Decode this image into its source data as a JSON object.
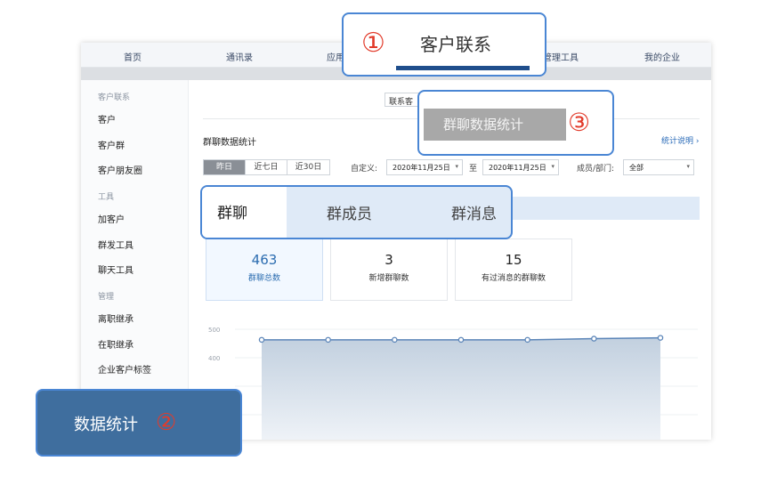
{
  "topnav": {
    "items": [
      "首页",
      "通讯录",
      "应用",
      "管理工具",
      "我的企业"
    ]
  },
  "sidebar": {
    "sections": [
      {
        "title": "客户联系",
        "items": [
          "客户",
          "客户群",
          "客户朋友圈"
        ]
      },
      {
        "title": "工具",
        "items": [
          "加客户",
          "群发工具",
          "聊天工具"
        ]
      },
      {
        "title": "管理",
        "items": [
          "离职继承",
          "在职继承",
          "企业客户标签"
        ]
      }
    ]
  },
  "main": {
    "tab_chip": "联系客",
    "page_title": "群聊数据统计",
    "help_link": "统计说明 ›",
    "filters": {
      "range_options": [
        "昨日",
        "近七日",
        "近30日"
      ],
      "range_active": 0,
      "custom_label": "自定义:",
      "date_from": "2020年11月25日",
      "to_label": "至",
      "date_to": "2020年11月25日",
      "member_label": "成员/部门:",
      "member_value": "全部"
    },
    "stats": [
      {
        "value": "463",
        "label": "群聊总数"
      },
      {
        "value": "3",
        "label": "新增群聊数"
      },
      {
        "value": "15",
        "label": "有过消息的群聊数"
      }
    ]
  },
  "chart_data": {
    "type": "area",
    "y_ticks": [
      "500",
      "400"
    ],
    "ylim": [
      0,
      500
    ],
    "x": [
      1,
      2,
      3,
      4,
      5,
      6,
      7
    ],
    "values": [
      463,
      463,
      463,
      463,
      463,
      467,
      470
    ],
    "colors": {
      "line": "#5b85b8",
      "fill_top": "#c2d0df",
      "fill_bottom": "#f3f6fa",
      "marker": "#5b85b8"
    }
  },
  "callouts": {
    "c1": {
      "number": "①",
      "text": "客户联系"
    },
    "c2": {
      "text": "数据统计",
      "number": "②"
    },
    "c3": {
      "text": "群聊数据统计",
      "number": "③"
    },
    "c4": {
      "tabs": [
        "群聊",
        "群成员",
        "群消息"
      ]
    }
  },
  "colors": {
    "accent": "#4a86d4",
    "callout_number": "#e23b2b",
    "callout_dark": "#3f6e9e",
    "underline": "#1f4e8c"
  }
}
